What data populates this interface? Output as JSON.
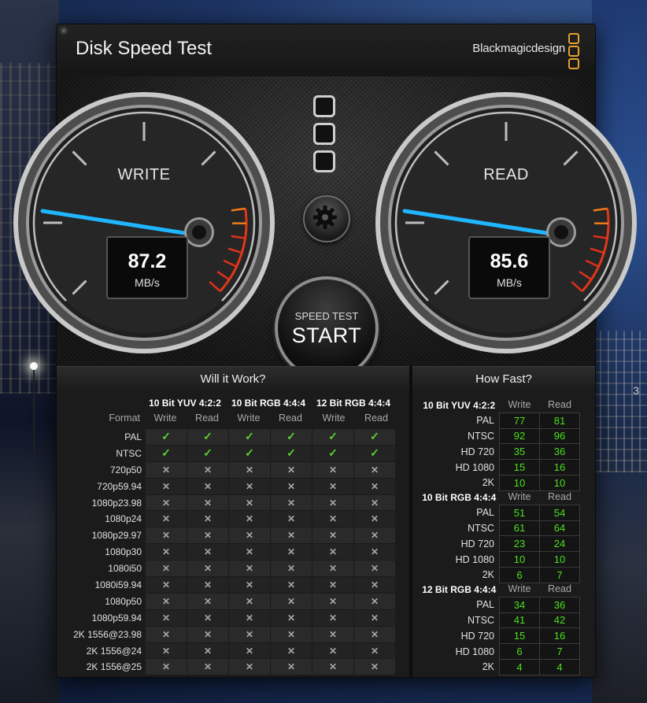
{
  "window": {
    "title": "Disk Speed Test",
    "brand": "Blackmagicdesign",
    "accent_color": "#e3a12a"
  },
  "gauges": {
    "write": {
      "label": "WRITE",
      "value": "87.2",
      "unit": "MB/s",
      "needle_color": "#1fb6ff"
    },
    "read": {
      "label": "READ",
      "value": "85.6",
      "unit": "MB/s",
      "needle_color": "#1fb6ff"
    }
  },
  "controls": {
    "settings_icon": "gear-icon",
    "start_line1": "SPEED TEST",
    "start_line2": "START"
  },
  "will_it_work": {
    "title": "Will it Work?",
    "format_label": "Format",
    "groups": [
      "10 Bit YUV 4:2:2",
      "10 Bit RGB 4:4:4",
      "12 Bit RGB 4:4:4"
    ],
    "write_label": "Write",
    "read_label": "Read",
    "ok_color": "#56d632",
    "rows": [
      {
        "format": "PAL",
        "cells": [
          "ok",
          "ok",
          "ok",
          "ok",
          "ok",
          "ok"
        ]
      },
      {
        "format": "NTSC",
        "cells": [
          "ok",
          "ok",
          "ok",
          "ok",
          "ok",
          "ok"
        ]
      },
      {
        "format": "720p50",
        "cells": [
          "no",
          "no",
          "no",
          "no",
          "no",
          "no"
        ]
      },
      {
        "format": "720p59.94",
        "cells": [
          "no",
          "no",
          "no",
          "no",
          "no",
          "no"
        ]
      },
      {
        "format": "1080p23.98",
        "cells": [
          "no",
          "no",
          "no",
          "no",
          "no",
          "no"
        ]
      },
      {
        "format": "1080p24",
        "cells": [
          "no",
          "no",
          "no",
          "no",
          "no",
          "no"
        ]
      },
      {
        "format": "1080p29.97",
        "cells": [
          "no",
          "no",
          "no",
          "no",
          "no",
          "no"
        ]
      },
      {
        "format": "1080p30",
        "cells": [
          "no",
          "no",
          "no",
          "no",
          "no",
          "no"
        ]
      },
      {
        "format": "1080i50",
        "cells": [
          "no",
          "no",
          "no",
          "no",
          "no",
          "no"
        ]
      },
      {
        "format": "1080i59.94",
        "cells": [
          "no",
          "no",
          "no",
          "no",
          "no",
          "no"
        ]
      },
      {
        "format": "1080p50",
        "cells": [
          "no",
          "no",
          "no",
          "no",
          "no",
          "no"
        ]
      },
      {
        "format": "1080p59.94",
        "cells": [
          "no",
          "no",
          "no",
          "no",
          "no",
          "no"
        ]
      },
      {
        "format": "2K 1556@23.98",
        "cells": [
          "no",
          "no",
          "no",
          "no",
          "no",
          "no"
        ]
      },
      {
        "format": "2K 1556@24",
        "cells": [
          "no",
          "no",
          "no",
          "no",
          "no",
          "no"
        ]
      },
      {
        "format": "2K 1556@25",
        "cells": [
          "no",
          "no",
          "no",
          "no",
          "no",
          "no"
        ]
      }
    ]
  },
  "how_fast": {
    "title": "How Fast?",
    "write_label": "Write",
    "read_label": "Read",
    "value_color": "#4ce01e",
    "groups": [
      {
        "name": "10 Bit YUV 4:2:2",
        "rows": [
          {
            "format": "PAL",
            "write": "77",
            "read": "81"
          },
          {
            "format": "NTSC",
            "write": "92",
            "read": "96"
          },
          {
            "format": "HD 720",
            "write": "35",
            "read": "36"
          },
          {
            "format": "HD 1080",
            "write": "15",
            "read": "16"
          },
          {
            "format": "2K",
            "write": "10",
            "read": "10"
          }
        ]
      },
      {
        "name": "10 Bit RGB 4:4:4",
        "rows": [
          {
            "format": "PAL",
            "write": "51",
            "read": "54"
          },
          {
            "format": "NTSC",
            "write": "61",
            "read": "64"
          },
          {
            "format": "HD 720",
            "write": "23",
            "read": "24"
          },
          {
            "format": "HD 1080",
            "write": "10",
            "read": "10"
          },
          {
            "format": "2K",
            "write": "6",
            "read": "7"
          }
        ]
      },
      {
        "name": "12 Bit RGB 4:4:4",
        "rows": [
          {
            "format": "PAL",
            "write": "34",
            "read": "36"
          },
          {
            "format": "NTSC",
            "write": "41",
            "read": "42"
          },
          {
            "format": "HD 720",
            "write": "15",
            "read": "16"
          },
          {
            "format": "HD 1080",
            "write": "6",
            "read": "7"
          },
          {
            "format": "2K",
            "write": "4",
            "read": "4"
          }
        ]
      }
    ]
  },
  "background": {
    "tower_number": "3"
  }
}
